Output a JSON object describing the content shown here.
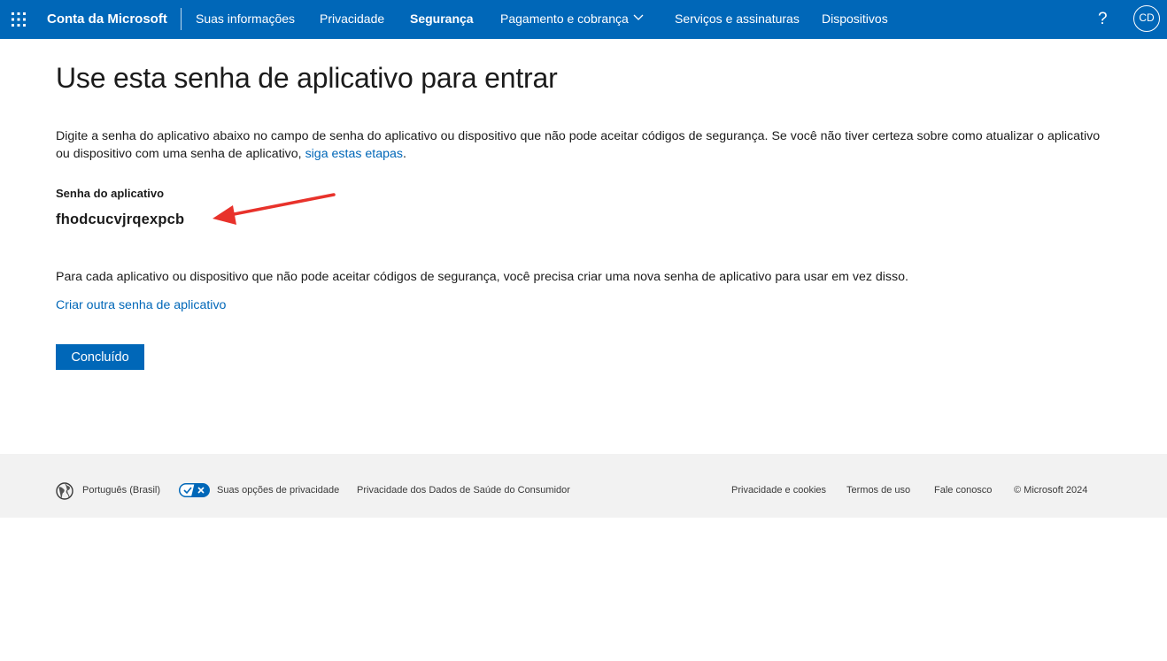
{
  "topbar": {
    "brand": "Conta da Microsoft",
    "nav": [
      "Suas informações",
      "Privacidade",
      "Segurança",
      "Pagamento e cobrança",
      "Serviços e assinaturas",
      "Dispositivos"
    ],
    "active": "Segurança",
    "help": "?",
    "avatar": "CD",
    "bg_color": "#0067b8"
  },
  "main": {
    "title": "Use esta senha de aplicativo para entrar",
    "intro_text": "Digite a senha do aplicativo abaixo no campo de senha do aplicativo ou dispositivo que não pode aceitar códigos de segurança. Se você não tiver certeza sobre como atualizar o aplicativo ou dispositivo com uma senha de aplicativo,",
    "intro_link": "siga estas etapas",
    "intro_end": ".",
    "password_label": "Senha do aplicativo",
    "password_value": "fhodcucvjrqexpcb",
    "paragraph": "Para cada aplicativo ou dispositivo que não pode aceitar códigos de segurança, você precisa criar uma nova senha de aplicativo para usar em vez disso.",
    "create_link": "Criar outra senha de aplicativo",
    "done_button": "Concluído",
    "accent_color": "#0067b8",
    "annotation_arrow_color": "#e8322b"
  },
  "footer": {
    "language": "Português (Brasil)",
    "privacy_choices": "Suas opções de privacidade",
    "health_privacy": "Privacidade dos Dados de Saúde do Consumidor",
    "privacy_cookies": "Privacidade e cookies",
    "terms": "Termos de uso",
    "contact": "Fale conosco",
    "copyright": "© Microsoft 2024"
  }
}
